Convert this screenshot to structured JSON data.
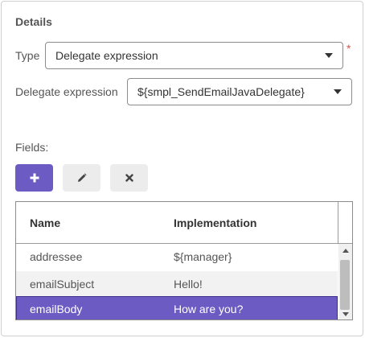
{
  "details": {
    "title": "Details",
    "type_label": "Type",
    "type_value": "Delegate expression",
    "required_marker": "*",
    "delegate_label": "Delegate expression",
    "delegate_value": "${smpl_SendEmailJavaDelegate}"
  },
  "fields": {
    "label": "Fields:",
    "toolbar": {
      "add_icon": "plus-icon",
      "edit_icon": "pencil-icon",
      "delete_icon": "x-icon"
    },
    "columns": [
      "Name",
      "Implementation"
    ],
    "rows": [
      {
        "name": "addressee",
        "implementation": "${manager}",
        "selected": false
      },
      {
        "name": "emailSubject",
        "implementation": "Hello!",
        "selected": false
      },
      {
        "name": "emailBody",
        "implementation": "How are you?",
        "selected": true
      }
    ]
  },
  "colors": {
    "accent": "#6c5bc3",
    "required": "#d9534f"
  }
}
